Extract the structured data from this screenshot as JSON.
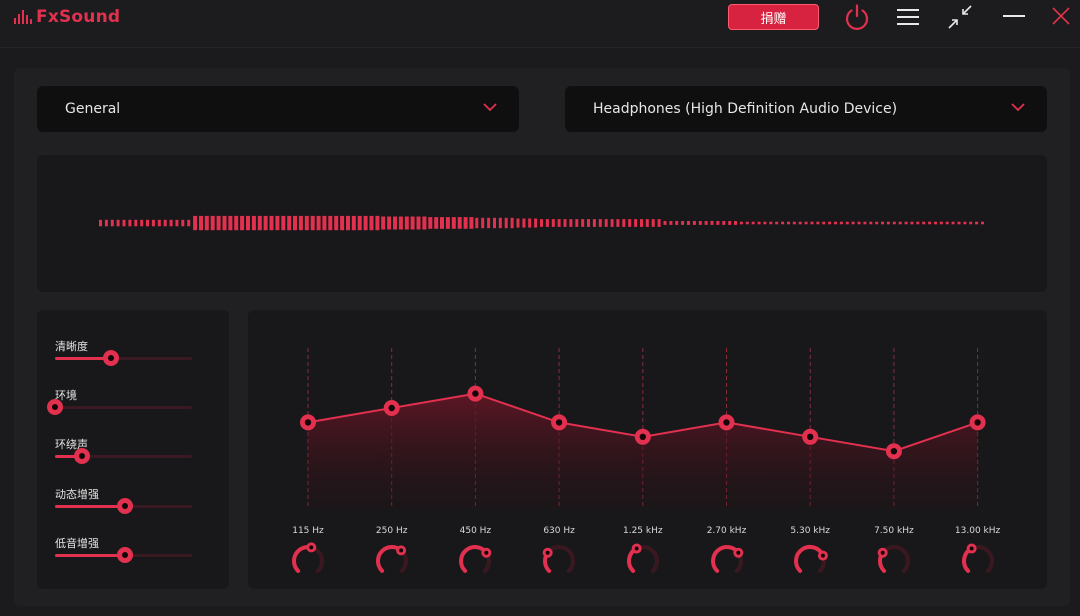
{
  "app": {
    "name": "FxSound",
    "donate_label": "捐赠",
    "accent_color": "#e2304f"
  },
  "titlebar_icons": [
    "power-icon",
    "menu-icon",
    "minimize-view-icon",
    "minimize-icon",
    "close-icon"
  ],
  "preset": {
    "selected": "General"
  },
  "output_device": {
    "selected": "Headphones (High Definition Audio Device)"
  },
  "visualizer": {
    "bar_levels": [
      0.25,
      0.25,
      0.25,
      0.25,
      0.25,
      0.25,
      0.25,
      0.25,
      0.25,
      0.25,
      0.25,
      0.25,
      0.25,
      0.25,
      0.25,
      0.25,
      0.55,
      0.55,
      0.55,
      0.55,
      0.55,
      0.55,
      0.55,
      0.55,
      0.55,
      0.55,
      0.55,
      0.55,
      0.55,
      0.55,
      0.55,
      0.55,
      0.55,
      0.55,
      0.55,
      0.55,
      0.55,
      0.55,
      0.55,
      0.55,
      0.55,
      0.55,
      0.55,
      0.55,
      0.55,
      0.55,
      0.55,
      0.55,
      0.5,
      0.5,
      0.5,
      0.5,
      0.5,
      0.5,
      0.5,
      0.5,
      0.45,
      0.45,
      0.45,
      0.45,
      0.45,
      0.45,
      0.45,
      0.45,
      0.4,
      0.4,
      0.4,
      0.4,
      0.4,
      0.4,
      0.4,
      0.35,
      0.35,
      0.35,
      0.35,
      0.3,
      0.3,
      0.3,
      0.3,
      0.3,
      0.3,
      0.3,
      0.3,
      0.3,
      0.3,
      0.3,
      0.3,
      0.3,
      0.3,
      0.3,
      0.3,
      0.3,
      0.3,
      0.3,
      0.3,
      0.3,
      0.15,
      0.15,
      0.15,
      0.15,
      0.15,
      0.15,
      0.15,
      0.15,
      0.15,
      0.15,
      0.15,
      0.15,
      0.15,
      0.1,
      0.1,
      0.1,
      0.1,
      0.1,
      0.1,
      0.1,
      0.1,
      0.1,
      0.1,
      0.1,
      0.1,
      0.1,
      0.1,
      0.1,
      0.1,
      0.1,
      0.1,
      0.1,
      0.1,
      0.1,
      0.1,
      0.1,
      0.1,
      0.1,
      0.1,
      0.1,
      0.1,
      0.1,
      0.1,
      0.1,
      0.1,
      0.1,
      0.1,
      0.1,
      0.1,
      0.1,
      0.1,
      0.1,
      0.1,
      0.1,
      0.1
    ]
  },
  "effects": [
    {
      "label": "清晰度",
      "level": 0.41
    },
    {
      "label": "环境",
      "level": 0.0
    },
    {
      "label": "环绕声",
      "level": 0.2
    },
    {
      "label": "动态增强",
      "level": 0.51
    },
    {
      "label": "低音增强",
      "level": 0.51
    }
  ],
  "equalizer": {
    "bands": [
      {
        "freq": "115 Hz",
        "gain": 0.38
      },
      {
        "freq": "250 Hz",
        "gain": 0.5
      },
      {
        "freq": "450 Hz",
        "gain": 0.62
      },
      {
        "freq": "630 Hz",
        "gain": 0.38
      },
      {
        "freq": "1.25 kHz",
        "gain": 0.26
      },
      {
        "freq": "2.70 kHz",
        "gain": 0.38
      },
      {
        "freq": "5.30 kHz",
        "gain": 0.26
      },
      {
        "freq": "7.50 kHz",
        "gain": 0.14
      },
      {
        "freq": "13.00 kHz",
        "gain": 0.38
      }
    ],
    "knob_levels": [
      0.55,
      0.65,
      0.7,
      0.3,
      0.4,
      0.7,
      0.75,
      0.3,
      0.4
    ]
  }
}
